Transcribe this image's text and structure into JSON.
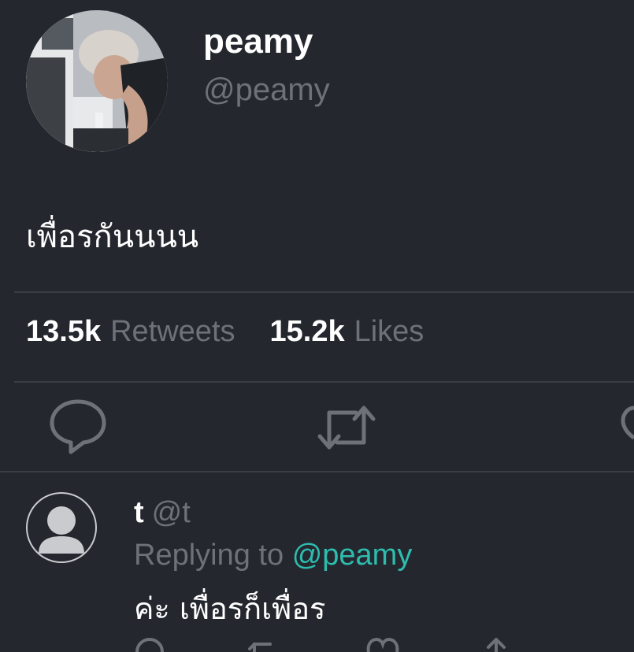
{
  "tweet": {
    "author_name": "peamy",
    "author_handle": "@peamy",
    "text": "เพื่อรกันนนน",
    "retweets_count": "13.5k",
    "retweets_label": "Retweets",
    "likes_count": "15.2k",
    "likes_label": "Likes",
    "actions": [
      "reply-icon",
      "retweet-icon",
      "like-icon"
    ]
  },
  "reply": {
    "name": "t",
    "handle": "@t",
    "replying_prefix": "Replying to",
    "replying_to": "@peamy",
    "text": "ค่ะ เพื่อรก็เพื่อร",
    "actions": [
      "reply-icon",
      "retweet-icon",
      "like-icon",
      "share-icon"
    ]
  },
  "colors": {
    "background": "#24272e",
    "muted": "#6e7177",
    "accent": "#2ebcae",
    "divider": "#3a3d43"
  }
}
